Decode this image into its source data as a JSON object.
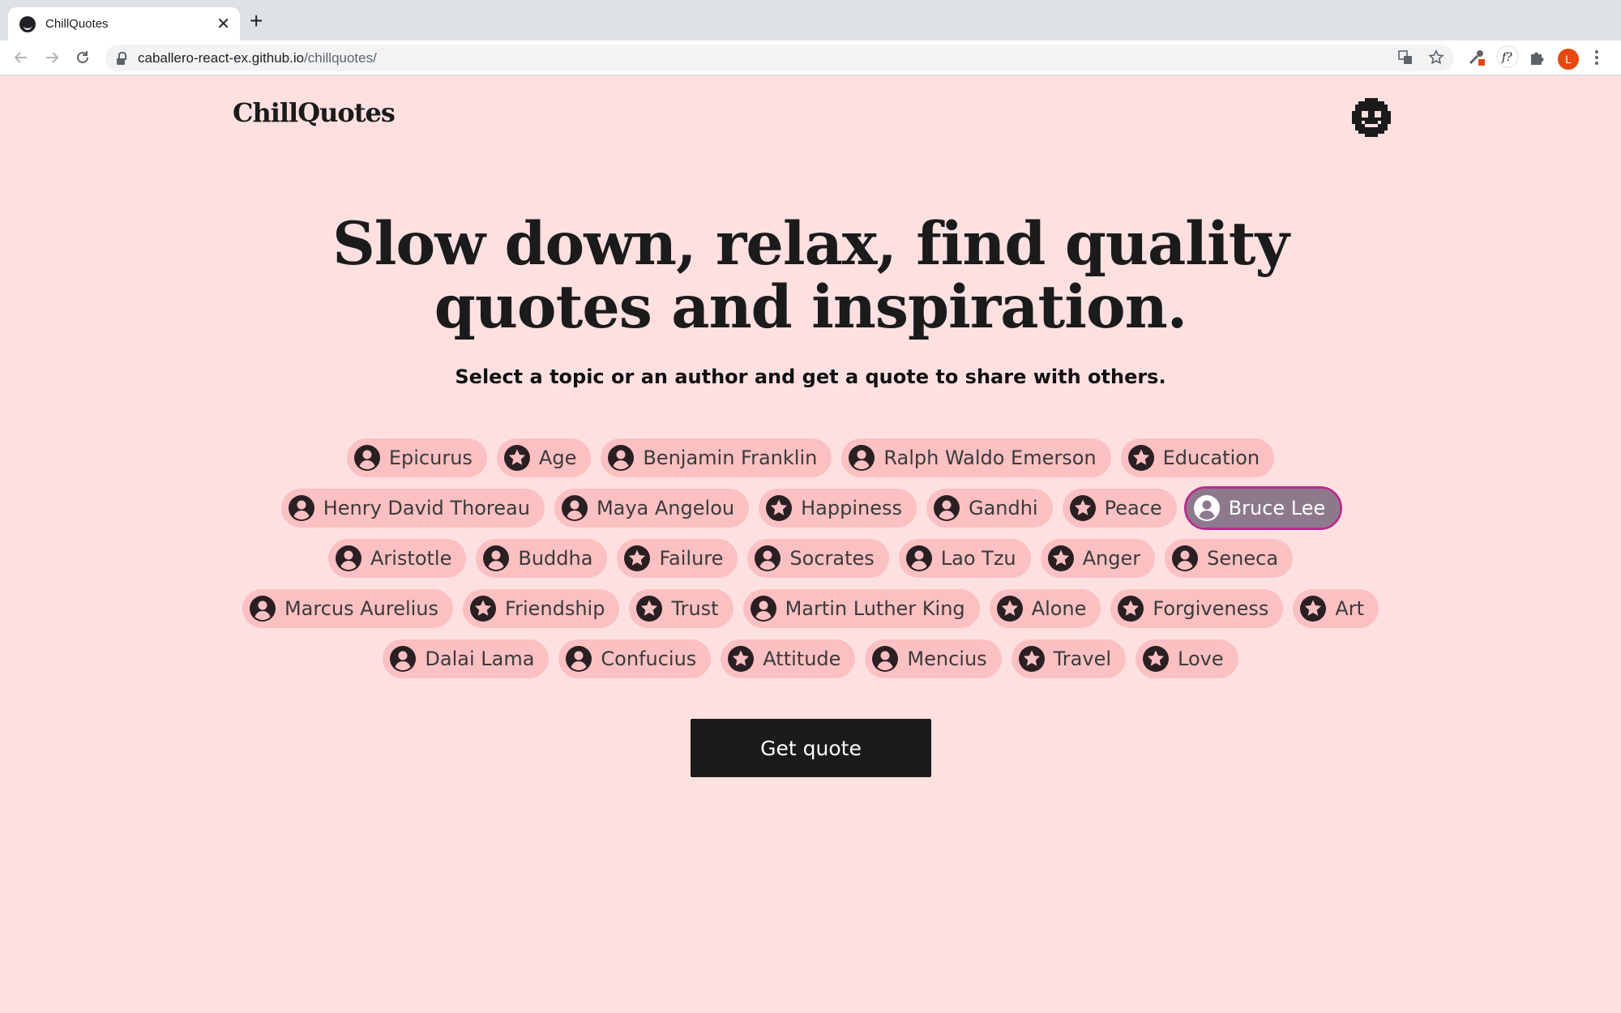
{
  "browser": {
    "tab_title": "ChillQuotes",
    "close_glyph": "✕",
    "new_tab_glyph": "+",
    "url_host": "caballero-react-ex.github.io",
    "url_path": "/chillquotes/",
    "profile_initial": "L",
    "profile_color": "#e8470f",
    "icons": [
      "back-arrow-icon",
      "forward-arrow-icon",
      "reload-icon",
      "lock-icon",
      "translate-icon",
      "bookmark-star-icon",
      "eyedropper-extension-icon",
      "font-extension-icon",
      "extensions-puzzle-icon",
      "kebab-menu-icon"
    ]
  },
  "header": {
    "logo": "ChillQuotes",
    "avatar_icon": "pixel-smiley-icon"
  },
  "hero": {
    "title_line1": "Slow down, relax, find quality",
    "title_line2": "quotes and inspiration.",
    "subtitle": "Select a topic or an author and get a quote to share with others."
  },
  "chips": [
    {
      "label": "Epicurus",
      "kind": "author"
    },
    {
      "label": "Age",
      "kind": "topic"
    },
    {
      "label": "Benjamin Franklin",
      "kind": "author"
    },
    {
      "label": "Ralph Waldo Emerson",
      "kind": "author"
    },
    {
      "label": "Education",
      "kind": "topic"
    },
    {
      "label": "Henry David Thoreau",
      "kind": "author"
    },
    {
      "label": "Maya Angelou",
      "kind": "author"
    },
    {
      "label": "Happiness",
      "kind": "topic"
    },
    {
      "label": "Gandhi",
      "kind": "author"
    },
    {
      "label": "Peace",
      "kind": "topic"
    },
    {
      "label": "Bruce Lee",
      "kind": "author",
      "selected": true
    },
    {
      "label": "Aristotle",
      "kind": "author"
    },
    {
      "label": "Buddha",
      "kind": "author"
    },
    {
      "label": "Failure",
      "kind": "topic"
    },
    {
      "label": "Socrates",
      "kind": "author"
    },
    {
      "label": "Lao Tzu",
      "kind": "author"
    },
    {
      "label": "Anger",
      "kind": "topic"
    },
    {
      "label": "Seneca",
      "kind": "author"
    },
    {
      "label": "Marcus Aurelius",
      "kind": "author"
    },
    {
      "label": "Friendship",
      "kind": "topic"
    },
    {
      "label": "Trust",
      "kind": "topic"
    },
    {
      "label": "Martin Luther King",
      "kind": "author"
    },
    {
      "label": "Alone",
      "kind": "topic"
    },
    {
      "label": "Forgiveness",
      "kind": "topic"
    },
    {
      "label": "Art",
      "kind": "topic"
    },
    {
      "label": "Dalai Lama",
      "kind": "author"
    },
    {
      "label": "Confucius",
      "kind": "author"
    },
    {
      "label": "Attitude",
      "kind": "topic"
    },
    {
      "label": "Mencius",
      "kind": "author"
    },
    {
      "label": "Travel",
      "kind": "topic"
    },
    {
      "label": "Love",
      "kind": "topic"
    }
  ],
  "cta": {
    "label": "Get quote"
  },
  "colors": {
    "page_bg": "#ffe0e1",
    "chip_bg": "#fbc0c2",
    "chip_selected_bg": "#8c7a8c",
    "chip_selected_outline": "#b32f8a",
    "button_bg": "#1b1b1b"
  }
}
